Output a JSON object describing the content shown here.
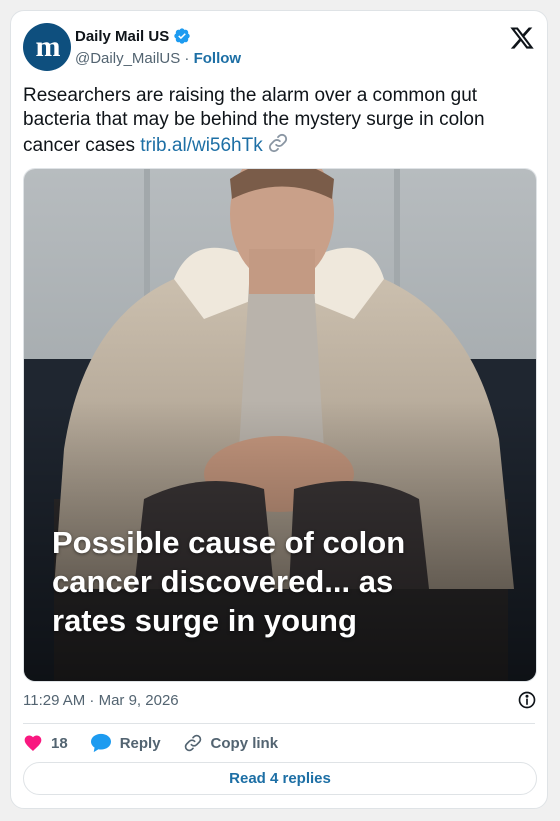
{
  "account": {
    "display_name": "Daily Mail US",
    "handle": "@Daily_MailUS",
    "separator": "·",
    "follow_label": "Follow",
    "avatar_glyph": "m",
    "verified_icon": "verified-badge-icon"
  },
  "tweet": {
    "text": "Researchers are raising the alarm over a common gut bacteria that may be behind the mystery surge in colon cancer cases",
    "link_text": "trib.al/wi56hTk",
    "link_icon": "chain-link-icon"
  },
  "media": {
    "headline": "Possible cause of colon cancer discovered... as rates surge in young"
  },
  "meta": {
    "timestamp": "11:29 AM · Mar 9, 2026",
    "info_icon": "info-icon"
  },
  "actions": {
    "like_count": "18",
    "reply_label": "Reply",
    "copy_link_label": "Copy link"
  },
  "replies_button": {
    "label": "Read 4 replies"
  },
  "colors": {
    "accent": "#1d6fa5",
    "like": "#f91880",
    "reply_bubble": "#1d9bf0",
    "avatar_bg": "#0e4f7e",
    "text_primary": "#0f1419",
    "text_secondary": "#536471"
  }
}
